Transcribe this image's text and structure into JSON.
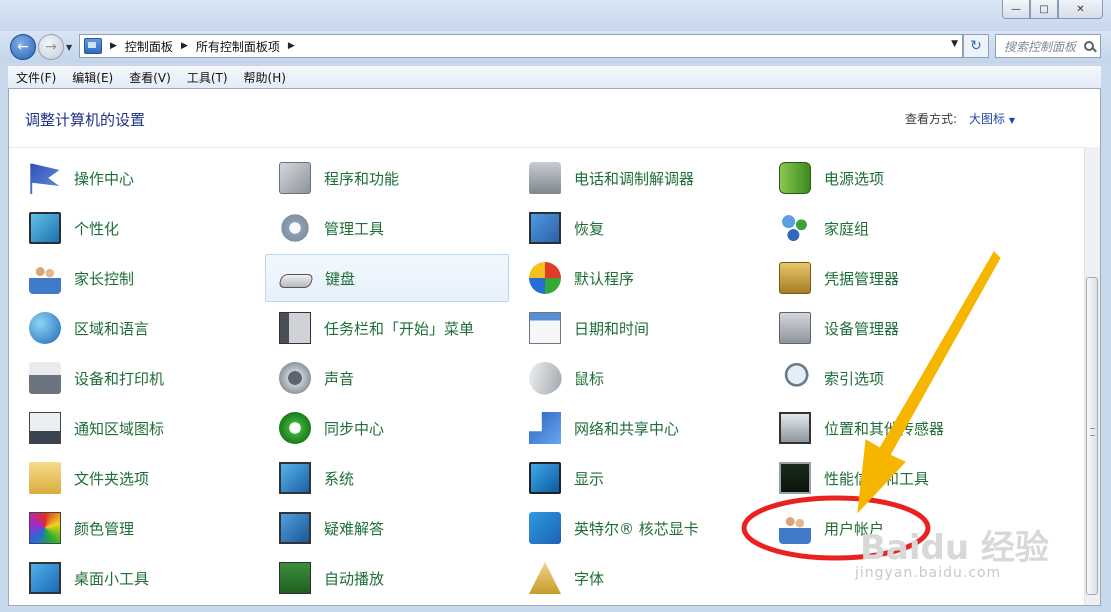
{
  "navigation": {
    "breadcrumbs": [
      "控制面板",
      "所有控制面板项"
    ],
    "search_placeholder": "搜索控制面板"
  },
  "menu": [
    "文件(F)",
    "编辑(E)",
    "查看(V)",
    "工具(T)",
    "帮助(H)"
  ],
  "header": {
    "title": "调整计算机的设置",
    "view_by_label": "查看方式:",
    "view_by_value": "大图标"
  },
  "items": [
    {
      "label": "操作中心",
      "icon": "action-center-icon"
    },
    {
      "label": "程序和功能",
      "icon": "programs-icon"
    },
    {
      "label": "电话和调制解调器",
      "icon": "phone-modem-icon"
    },
    {
      "label": "电源选项",
      "icon": "power-options-icon"
    },
    {
      "label": "个性化",
      "icon": "personalization-icon"
    },
    {
      "label": "管理工具",
      "icon": "admin-tools-icon"
    },
    {
      "label": "恢复",
      "icon": "recovery-icon"
    },
    {
      "label": "家庭组",
      "icon": "homegroup-icon"
    },
    {
      "label": "家长控制",
      "icon": "parental-controls-icon"
    },
    {
      "label": "键盘",
      "icon": "keyboard-icon"
    },
    {
      "label": "默认程序",
      "icon": "default-programs-icon"
    },
    {
      "label": "凭据管理器",
      "icon": "credential-manager-icon"
    },
    {
      "label": "区域和语言",
      "icon": "region-language-icon"
    },
    {
      "label": "任务栏和「开始」菜单",
      "icon": "taskbar-icon"
    },
    {
      "label": "日期和时间",
      "icon": "date-time-icon"
    },
    {
      "label": "设备管理器",
      "icon": "device-manager-icon"
    },
    {
      "label": "设备和打印机",
      "icon": "devices-printers-icon"
    },
    {
      "label": "声音",
      "icon": "sound-icon"
    },
    {
      "label": "鼠标",
      "icon": "mouse-icon"
    },
    {
      "label": "索引选项",
      "icon": "indexing-icon"
    },
    {
      "label": "通知区域图标",
      "icon": "notification-area-icon"
    },
    {
      "label": "同步中心",
      "icon": "sync-center-icon"
    },
    {
      "label": "网络和共享中心",
      "icon": "network-sharing-icon"
    },
    {
      "label": "位置和其他传感器",
      "icon": "location-sensors-icon"
    },
    {
      "label": "文件夹选项",
      "icon": "folder-options-icon"
    },
    {
      "label": "系统",
      "icon": "system-icon"
    },
    {
      "label": "显示",
      "icon": "display-icon"
    },
    {
      "label": "性能信息和工具",
      "icon": "performance-icon"
    },
    {
      "label": "颜色管理",
      "icon": "color-management-icon"
    },
    {
      "label": "疑难解答",
      "icon": "troubleshooting-icon"
    },
    {
      "label": "英特尔® 核芯显卡",
      "icon": "intel-graphics-icon"
    },
    {
      "label": "用户帐户",
      "icon": "user-accounts-icon"
    },
    {
      "label": "桌面小工具",
      "icon": "desktop-gadgets-icon"
    },
    {
      "label": "自动播放",
      "icon": "autoplay-icon"
    },
    {
      "label": "字体",
      "icon": "fonts-icon"
    }
  ],
  "selected_item": "键盘",
  "annotation": {
    "arrow_color": "#f6b600",
    "ellipse_color": "#e8231f"
  },
  "watermark": {
    "logo": "Baidu 经验",
    "url": "jingyan.baidu.com"
  }
}
